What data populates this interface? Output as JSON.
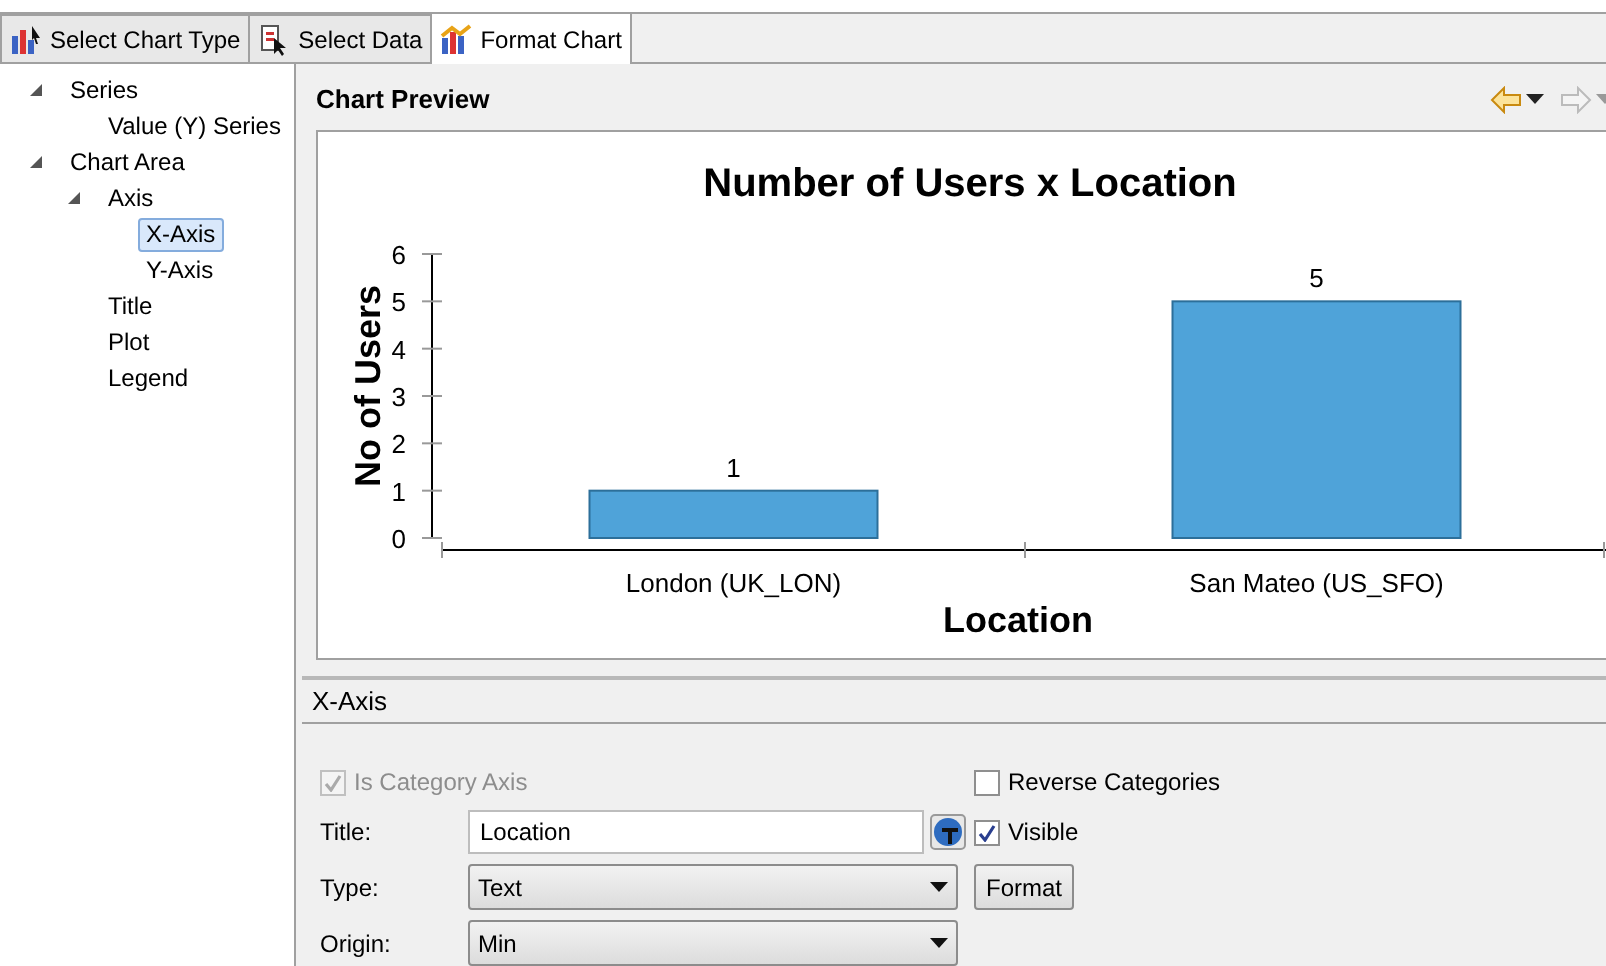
{
  "tabs": [
    {
      "label": "Select Chart Type",
      "selected": false
    },
    {
      "label": "Select Data",
      "selected": false
    },
    {
      "label": "Format Chart",
      "selected": true
    }
  ],
  "tree": [
    {
      "label": "Series",
      "expanded": true,
      "selected": false,
      "children": [
        {
          "label": "Value (Y) Series",
          "selected": false
        }
      ]
    },
    {
      "label": "Chart Area",
      "expanded": true,
      "selected": false,
      "children": [
        {
          "label": "Axis",
          "expanded": true,
          "selected": false,
          "children": [
            {
              "label": "X-Axis",
              "selected": true
            },
            {
              "label": "Y-Axis",
              "selected": false
            }
          ]
        },
        {
          "label": "Title",
          "selected": false
        },
        {
          "label": "Plot",
          "selected": false
        },
        {
          "label": "Legend",
          "selected": false
        }
      ]
    }
  ],
  "preview": {
    "title": "Chart Preview",
    "chart_data": {
      "type": "bar",
      "title": "Number of Users x Location",
      "xlabel": "Location",
      "ylabel": "No of Users",
      "categories": [
        "London (UK_LON)",
        "San Mateo (US_SFO)"
      ],
      "values": [
        1,
        5
      ],
      "ylim": [
        0,
        6
      ],
      "yticks": [
        0,
        1,
        2,
        3,
        4,
        5,
        6
      ],
      "data_labels": true
    }
  },
  "section": {
    "title": "X-Axis",
    "is_category_axis": {
      "label": "Is Category Axis",
      "checked": true,
      "disabled": true
    },
    "reverse_categories": {
      "label": "Reverse Categories",
      "checked": false,
      "disabled": false
    },
    "title_field": {
      "label": "Title:",
      "value": "Location"
    },
    "visible": {
      "label": "Visible",
      "checked": true,
      "disabled": false
    },
    "type_field": {
      "label": "Type:",
      "value": "Text"
    },
    "format_button": "Format",
    "origin_field": {
      "label": "Origin:",
      "value": "Min"
    }
  }
}
